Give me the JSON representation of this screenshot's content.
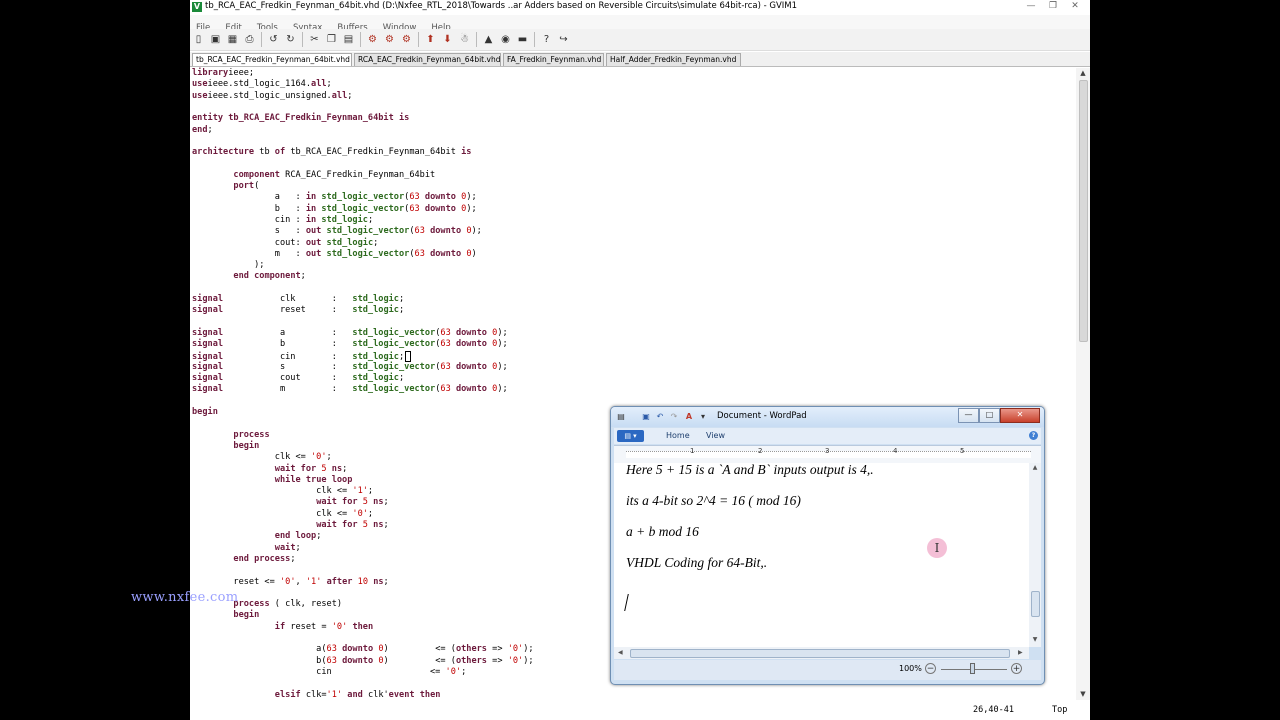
{
  "gvim": {
    "title": "tb_RCA_EAC_Fredkin_Feynman_64bit.vhd (D:\\Nxfee_RTL_2018\\Towards ..ar Adders based on Reversible Circuits\\simulate 64bit-rca) - GVIM1",
    "menu": [
      "File",
      "Edit",
      "Tools",
      "Syntax",
      "Buffers",
      "Window",
      "Help"
    ],
    "tabs": [
      "tb_RCA_EAC_Fredkin_Feynman_64bit.vhd",
      "RCA_EAC_Fredkin_Feynman_64bit.vhd",
      "FA_Fredkin_Feynman.vhd",
      "Half_Adder_Fredkin_Feynman.vhd"
    ],
    "active_tab": 0,
    "code_lines": [
      [
        [
          "k",
          "library"
        ],
        [
          "",
          "ieee;"
        ]
      ],
      [
        [
          "k",
          "use"
        ],
        [
          "",
          "ieee.std_logic_1164."
        ],
        [
          "k",
          "all"
        ],
        [
          "",
          ";"
        ]
      ],
      [
        [
          "k",
          "use"
        ],
        [
          "",
          "ieee.std_logic_unsigned."
        ],
        [
          "k",
          "all"
        ],
        [
          "",
          ";"
        ]
      ],
      [],
      [
        [
          "k",
          "entity"
        ],
        [
          "k",
          " tb_RCA_EAC_Fredkin_Feynman_64bit is"
        ]
      ],
      [
        [
          "k",
          "end"
        ],
        [
          "",
          ";"
        ]
      ],
      [],
      [
        [
          "k",
          "architecture"
        ],
        [
          "",
          " tb "
        ],
        [
          "k",
          "of"
        ],
        [
          "",
          " tb_RCA_EAC_Fredkin_Feynman_64bit "
        ],
        [
          "k",
          "is"
        ]
      ],
      [],
      [
        [
          "",
          "        "
        ],
        [
          "k",
          "component"
        ],
        [
          "",
          " RCA_EAC_Fredkin_Feynman_64bit"
        ]
      ],
      [
        [
          "",
          "        "
        ],
        [
          "k",
          "port"
        ],
        [
          "",
          "("
        ]
      ],
      [
        [
          "",
          "                a   : "
        ],
        [
          "k",
          "in"
        ],
        [
          "",
          " "
        ],
        [
          "t",
          "std_logic_vector"
        ],
        [
          "",
          "("
        ],
        [
          "n",
          "63"
        ],
        [
          "",
          " "
        ],
        [
          "k",
          "downto"
        ],
        [
          "",
          " "
        ],
        [
          "n",
          "0"
        ],
        [
          "",
          ");"
        ]
      ],
      [
        [
          "",
          "                b   : "
        ],
        [
          "k",
          "in"
        ],
        [
          "",
          " "
        ],
        [
          "t",
          "std_logic_vector"
        ],
        [
          "",
          "("
        ],
        [
          "n",
          "63"
        ],
        [
          "",
          " "
        ],
        [
          "k",
          "downto"
        ],
        [
          "",
          " "
        ],
        [
          "n",
          "0"
        ],
        [
          "",
          ");"
        ]
      ],
      [
        [
          "",
          "                cin : "
        ],
        [
          "k",
          "in"
        ],
        [
          "",
          " "
        ],
        [
          "t",
          "std_logic"
        ],
        [
          "",
          ";"
        ]
      ],
      [
        [
          "",
          "                s   : "
        ],
        [
          "k",
          "out"
        ],
        [
          "",
          " "
        ],
        [
          "t",
          "std_logic_vector"
        ],
        [
          "",
          "("
        ],
        [
          "n",
          "63"
        ],
        [
          "",
          " "
        ],
        [
          "k",
          "downto"
        ],
        [
          "",
          " "
        ],
        [
          "n",
          "0"
        ],
        [
          "",
          ");"
        ]
      ],
      [
        [
          "",
          "                cout: "
        ],
        [
          "k",
          "out"
        ],
        [
          "",
          " "
        ],
        [
          "t",
          "std_logic"
        ],
        [
          "",
          ";"
        ]
      ],
      [
        [
          "",
          "                m   : "
        ],
        [
          "k",
          "out"
        ],
        [
          "",
          " "
        ],
        [
          "t",
          "std_logic_vector"
        ],
        [
          "",
          "("
        ],
        [
          "n",
          "63"
        ],
        [
          "",
          " "
        ],
        [
          "k",
          "downto"
        ],
        [
          "",
          " "
        ],
        [
          "n",
          "0"
        ],
        [
          "",
          ")"
        ]
      ],
      [
        [
          "",
          "            );"
        ]
      ],
      [
        [
          "",
          "        "
        ],
        [
          "k",
          "end component"
        ],
        [
          "",
          ";"
        ]
      ],
      [],
      [
        [
          "k",
          "signal"
        ],
        [
          "",
          "           clk       :   "
        ],
        [
          "t",
          "std_logic"
        ],
        [
          "",
          ";"
        ]
      ],
      [
        [
          "k",
          "signal"
        ],
        [
          "",
          "           reset     :   "
        ],
        [
          "t",
          "std_logic"
        ],
        [
          "",
          ";"
        ]
      ],
      [],
      [
        [
          "k",
          "signal"
        ],
        [
          "",
          "           a         :   "
        ],
        [
          "t",
          "std_logic_vector"
        ],
        [
          "",
          "("
        ],
        [
          "n",
          "63"
        ],
        [
          "",
          " "
        ],
        [
          "k",
          "downto"
        ],
        [
          "",
          " "
        ],
        [
          "n",
          "0"
        ],
        [
          "",
          ");"
        ]
      ],
      [
        [
          "k",
          "signal"
        ],
        [
          "",
          "           b         :   "
        ],
        [
          "t",
          "std_logic_vector"
        ],
        [
          "",
          "("
        ],
        [
          "n",
          "63"
        ],
        [
          "",
          " "
        ],
        [
          "k",
          "downto"
        ],
        [
          "",
          " "
        ],
        [
          "n",
          "0"
        ],
        [
          "",
          ");"
        ]
      ],
      [
        [
          "k",
          "signal"
        ],
        [
          "",
          "           cin       :   "
        ],
        [
          "t",
          "std_logic"
        ],
        [
          "c",
          ";"
        ]
      ],
      [
        [
          "k",
          "signal"
        ],
        [
          "",
          "           s         :   "
        ],
        [
          "t",
          "std_logic_vector"
        ],
        [
          "",
          "("
        ],
        [
          "n",
          "63"
        ],
        [
          "",
          " "
        ],
        [
          "k",
          "downto"
        ],
        [
          "",
          " "
        ],
        [
          "n",
          "0"
        ],
        [
          "",
          ");"
        ]
      ],
      [
        [
          "k",
          "signal"
        ],
        [
          "",
          "           cout      :   "
        ],
        [
          "t",
          "std_logic"
        ],
        [
          "",
          ";"
        ]
      ],
      [
        [
          "k",
          "signal"
        ],
        [
          "",
          "           m         :   "
        ],
        [
          "t",
          "std_logic_vector"
        ],
        [
          "",
          "("
        ],
        [
          "n",
          "63"
        ],
        [
          "",
          " "
        ],
        [
          "k",
          "downto"
        ],
        [
          "",
          " "
        ],
        [
          "n",
          "0"
        ],
        [
          "",
          ");"
        ]
      ],
      [],
      [
        [
          "k",
          "begin"
        ]
      ],
      [],
      [
        [
          "",
          "        "
        ],
        [
          "k",
          "process"
        ]
      ],
      [
        [
          "",
          "        "
        ],
        [
          "k",
          "begin"
        ]
      ],
      [
        [
          "",
          "                clk <= "
        ],
        [
          "s",
          "'0'"
        ],
        [
          "",
          ";"
        ]
      ],
      [
        [
          "",
          "                "
        ],
        [
          "k",
          "wait for"
        ],
        [
          "",
          " "
        ],
        [
          "n",
          "5"
        ],
        [
          "",
          " "
        ],
        [
          "k",
          "ns"
        ],
        [
          "",
          ";"
        ]
      ],
      [
        [
          "",
          "                "
        ],
        [
          "k",
          "while true loop"
        ]
      ],
      [
        [
          "",
          "                        clk <= "
        ],
        [
          "s",
          "'1'"
        ],
        [
          "",
          ";"
        ]
      ],
      [
        [
          "",
          "                        "
        ],
        [
          "k",
          "wait for"
        ],
        [
          "",
          " "
        ],
        [
          "n",
          "5"
        ],
        [
          "",
          " "
        ],
        [
          "k",
          "ns"
        ],
        [
          "",
          ";"
        ]
      ],
      [
        [
          "",
          "                        clk <= "
        ],
        [
          "s",
          "'0'"
        ],
        [
          "",
          ";"
        ]
      ],
      [
        [
          "",
          "                        "
        ],
        [
          "k",
          "wait for"
        ],
        [
          "",
          " "
        ],
        [
          "n",
          "5"
        ],
        [
          "",
          " "
        ],
        [
          "k",
          "ns"
        ],
        [
          "",
          ";"
        ]
      ],
      [
        [
          "",
          "                "
        ],
        [
          "k",
          "end loop"
        ],
        [
          "",
          ";"
        ]
      ],
      [
        [
          "",
          "                "
        ],
        [
          "k",
          "wait"
        ],
        [
          "",
          ";"
        ]
      ],
      [
        [
          "",
          "        "
        ],
        [
          "k",
          "end process"
        ],
        [
          "",
          ";"
        ]
      ],
      [],
      [
        [
          "",
          "        reset <= "
        ],
        [
          "s",
          "'0'"
        ],
        [
          "",
          ", "
        ],
        [
          "s",
          "'1'"
        ],
        [
          "",
          " "
        ],
        [
          "k",
          "after"
        ],
        [
          "",
          " "
        ],
        [
          "n",
          "10"
        ],
        [
          "",
          " "
        ],
        [
          "k",
          "ns"
        ],
        [
          "",
          ";"
        ]
      ],
      [],
      [
        [
          "",
          "        "
        ],
        [
          "k",
          "process"
        ],
        [
          "",
          " ( clk, reset)"
        ]
      ],
      [
        [
          "",
          "        "
        ],
        [
          "k",
          "begin"
        ]
      ],
      [
        [
          "",
          "                "
        ],
        [
          "k",
          "if"
        ],
        [
          "",
          " reset = "
        ],
        [
          "s",
          "'0'"
        ],
        [
          "",
          " "
        ],
        [
          "k",
          "then"
        ]
      ],
      [],
      [
        [
          "",
          "                        a("
        ],
        [
          "n",
          "63"
        ],
        [
          "",
          " "
        ],
        [
          "k",
          "downto"
        ],
        [
          "",
          " "
        ],
        [
          "n",
          "0"
        ],
        [
          "",
          ")         <= ("
        ],
        [
          "k",
          "others"
        ],
        [
          "",
          " => "
        ],
        [
          "s",
          "'0'"
        ],
        [
          "",
          ");"
        ]
      ],
      [
        [
          "",
          "                        b("
        ],
        [
          "n",
          "63"
        ],
        [
          "",
          " "
        ],
        [
          "k",
          "downto"
        ],
        [
          "",
          " "
        ],
        [
          "n",
          "0"
        ],
        [
          "",
          ")         <= ("
        ],
        [
          "k",
          "others"
        ],
        [
          "",
          " => "
        ],
        [
          "s",
          "'0'"
        ],
        [
          "",
          ");"
        ]
      ],
      [
        [
          "",
          "                        cin                   <= "
        ],
        [
          "s",
          "'0'"
        ],
        [
          "",
          ";"
        ]
      ],
      [],
      [
        [
          "",
          "                "
        ],
        [
          "k",
          "elsif"
        ],
        [
          "",
          " clk="
        ],
        [
          "s",
          "'1'"
        ],
        [
          "",
          " "
        ],
        [
          "k",
          "and"
        ],
        [
          "",
          " clk'"
        ],
        [
          "k",
          "event"
        ],
        [
          "",
          " "
        ],
        [
          "k",
          "then"
        ]
      ]
    ],
    "status_position": "26,40-41",
    "status_scroll": "Top"
  },
  "watermark": "www.nxfee.com",
  "wordpad": {
    "title": "Document - WordPad",
    "ribbon_tabs": [
      "Home",
      "View"
    ],
    "ruler_numbers": [
      "1",
      "2",
      "3",
      "4",
      "5"
    ],
    "lines": [
      "Here 5 + 15 is a `A and B` inputs output is 4,.",
      "its a 4-bit so 2^4 = 16 ( mod 16)",
      "a + b mod 16",
      "VHDL Coding for 64-Bit,."
    ],
    "zoom": "100%"
  }
}
